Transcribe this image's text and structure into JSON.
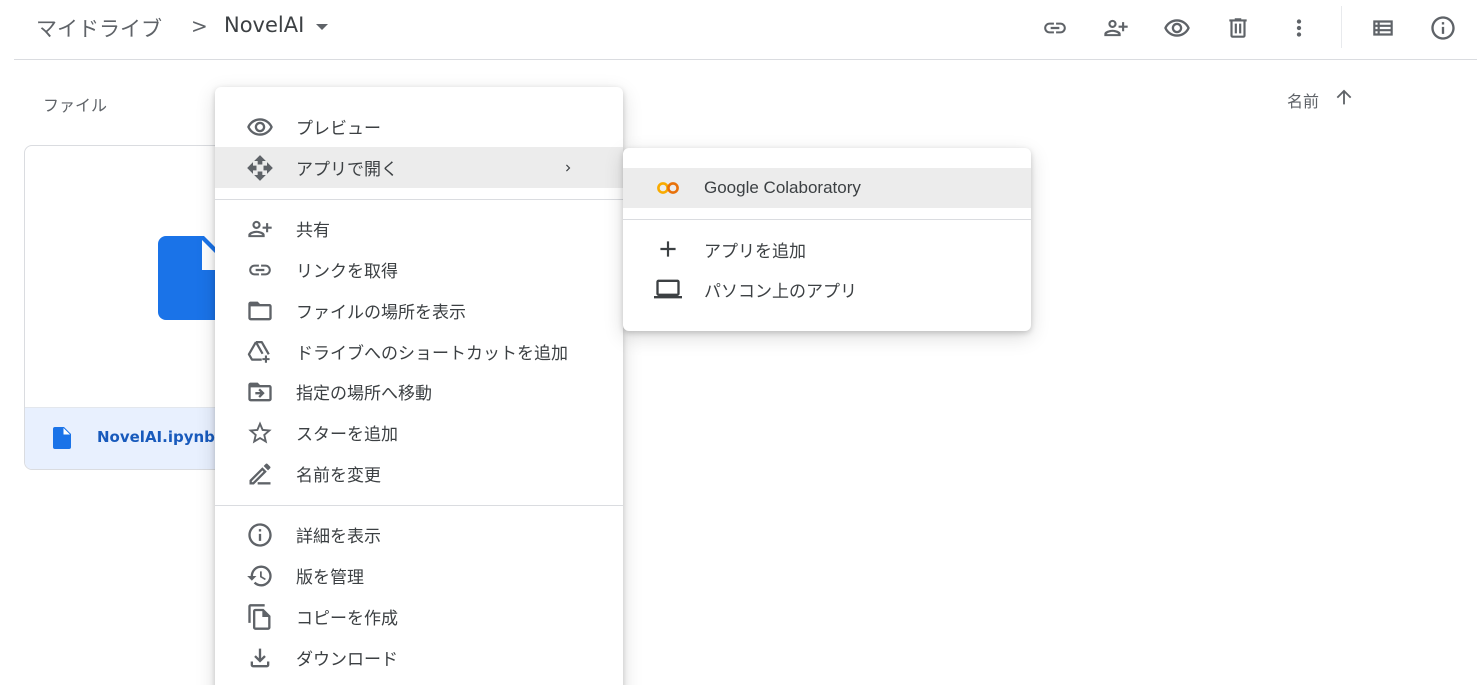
{
  "breadcrumb": {
    "root": "マイドライブ",
    "separator": ">",
    "current": "NovelAI"
  },
  "toolbar": {
    "icons": [
      "link-icon",
      "add-person-icon",
      "eye-icon",
      "trash-icon",
      "more-vert-icon",
      "list-view-icon",
      "info-icon"
    ]
  },
  "main": {
    "section_label": "ファイル",
    "sort_label": "名前",
    "sort_direction": "ascending"
  },
  "file": {
    "name": "NovelAI.ipynb",
    "icon": "document-icon",
    "color": "#1a73e8"
  },
  "context_menu": {
    "items": [
      {
        "label": "プレビュー",
        "icon": "eye-icon"
      },
      {
        "label": "アプリで開く",
        "icon": "move-arrows-icon",
        "has_submenu": true
      },
      {
        "label": "共有",
        "icon": "add-person-icon"
      },
      {
        "label": "リンクを取得",
        "icon": "link-icon"
      },
      {
        "label": "ファイルの場所を表示",
        "icon": "folder-icon"
      },
      {
        "label": "ドライブへのショートカットを追加",
        "icon": "drive-shortcut-icon"
      },
      {
        "label": "指定の場所へ移動",
        "icon": "move-to-folder-icon"
      },
      {
        "label": "スターを追加",
        "icon": "star-icon"
      },
      {
        "label": "名前を変更",
        "icon": "rename-icon"
      },
      {
        "label": "詳細を表示",
        "icon": "info-icon"
      },
      {
        "label": "版を管理",
        "icon": "history-icon"
      },
      {
        "label": "コピーを作成",
        "icon": "copy-icon"
      },
      {
        "label": "ダウンロード",
        "icon": "download-icon"
      }
    ]
  },
  "submenu": {
    "items": [
      {
        "label": "Google Colaboratory",
        "icon": "colab-icon"
      },
      {
        "label": "アプリを追加",
        "icon": "plus-icon"
      },
      {
        "label": "パソコン上のアプリ",
        "icon": "laptop-icon"
      }
    ]
  },
  "colors": {
    "colab_orange": "#f9ab00",
    "colab_dark_orange": "#e8710a",
    "selection_blue": "#e8f0fe",
    "text_blue": "#185abc"
  }
}
